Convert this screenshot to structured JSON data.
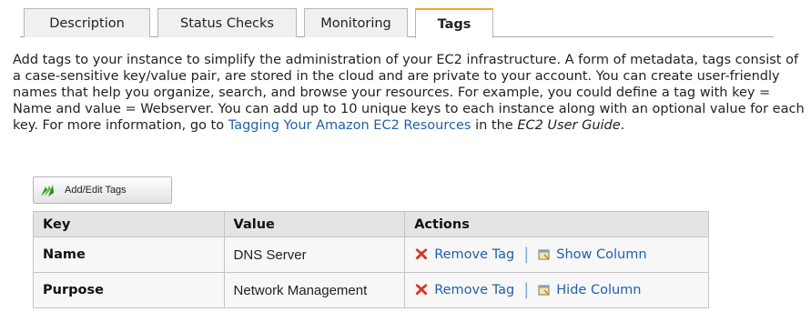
{
  "tabs": [
    {
      "label": "Description"
    },
    {
      "label": "Status Checks"
    },
    {
      "label": "Monitoring"
    },
    {
      "label": "Tags",
      "active": true
    }
  ],
  "description": {
    "text_before_link": "Add tags to your instance to simplify the administration of your EC2 infrastructure. A form of metadata, tags consist of a case-sensitive key/value pair, are stored in the cloud and are private to your account. You can create user-friendly names that help you organize, search, and browse your resources. For example, you could define a tag with key = Name and value = Webserver. You can add up to 10 unique keys to each instance along with an optional value for each key. For more information, go to ",
    "link_text": "Tagging Your Amazon EC2 Resources",
    "text_after_link": " in the ",
    "guide_text": "EC2 User Guide",
    "period": "."
  },
  "add_button": {
    "label": "Add/Edit Tags",
    "icon": "add-tags-icon"
  },
  "table": {
    "headers": [
      "Key",
      "Value",
      "Actions"
    ],
    "rows": [
      {
        "key": "Name",
        "value": "DNS Server",
        "remove_label": "Remove Tag",
        "column_label": "Show Column"
      },
      {
        "key": "Purpose",
        "value": "Network Management",
        "remove_label": "Remove Tag",
        "column_label": "Hide Column"
      }
    ]
  },
  "colors": {
    "active_tab_accent": "#f5a623",
    "link": "#2160a8",
    "remove_icon": "#d9341e"
  }
}
